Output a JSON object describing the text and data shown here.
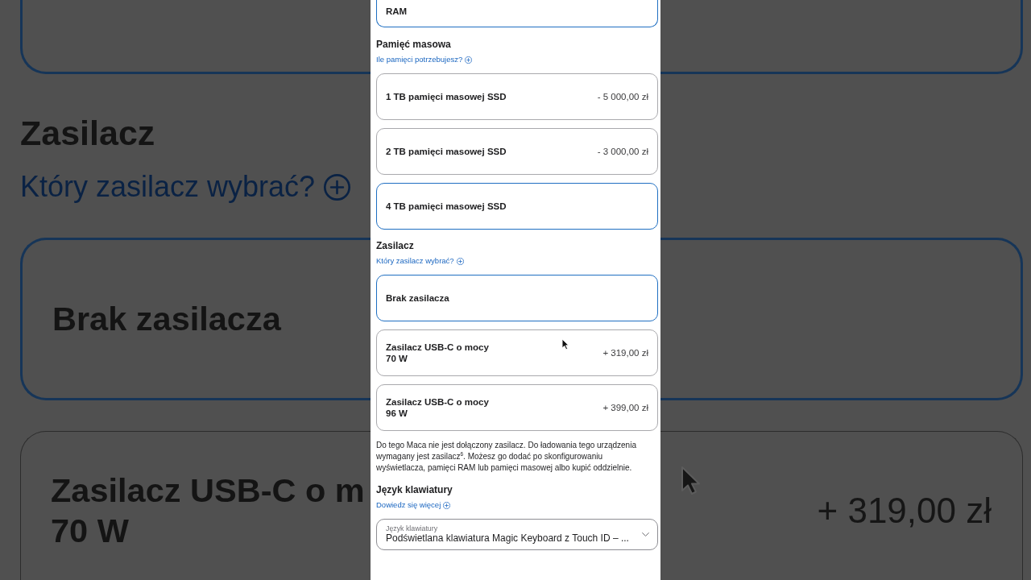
{
  "backdrop": {
    "top_option": {
      "selected": true
    },
    "heading": "Zasilacz",
    "link": "Który zasilacz wybrać?",
    "options": [
      {
        "label_lines": [
          "Brak zasilacza"
        ],
        "selected": true
      },
      {
        "label_lines": [
          "Zasilacz USB-C o m",
          "70 W"
        ],
        "price": "+ 319,00 zł",
        "selected": false
      }
    ]
  },
  "panel": {
    "top_option": {
      "label_lines": [
        "RAM"
      ],
      "selected": true
    },
    "sections": [
      {
        "kind": "options",
        "heading": "Pamięć masowa",
        "link": "Ile pamięci potrzebujesz?",
        "options": [
          {
            "label_lines": [
              "1 TB pamięci masowej SSD"
            ],
            "price": "- 5 000,00 zł",
            "selected": false
          },
          {
            "label_lines": [
              "2 TB pamięci masowej SSD"
            ],
            "price": "- 3 000,00 zł",
            "selected": false
          },
          {
            "label_lines": [
              "4 TB pamięci masowej SSD"
            ],
            "selected": true
          }
        ]
      },
      {
        "kind": "options",
        "heading": "Zasilacz",
        "link": "Który zasilacz wybrać?",
        "options": [
          {
            "label_lines": [
              "Brak zasilacza"
            ],
            "selected": true
          },
          {
            "label_lines": [
              "Zasilacz USB-C o mocy",
              "70 W"
            ],
            "price": "+ 319,00 zł",
            "selected": false
          },
          {
            "label_lines": [
              "Zasilacz USB-C o mocy",
              "96 W"
            ],
            "price": "+ 399,00 zł",
            "selected": false
          }
        ],
        "note": "Do tego Maca nie jest dołączony zasilacz. Do ładowania tego urządzenia wymagany jest zasilacz$^{6}$. Możesz go dodać po skonfigurowaniu wyświetlacza, pamięci RAM lub pamięci masowej albo kupić oddzielnie."
      },
      {
        "kind": "select",
        "heading": "Język klawiatury",
        "link": "Dowiedz się więcej",
        "select": {
          "label": "Język klawiatury",
          "value": "Podświetlana klawiatura Magic Keyboard z Touch ID – ..."
        }
      }
    ]
  }
}
